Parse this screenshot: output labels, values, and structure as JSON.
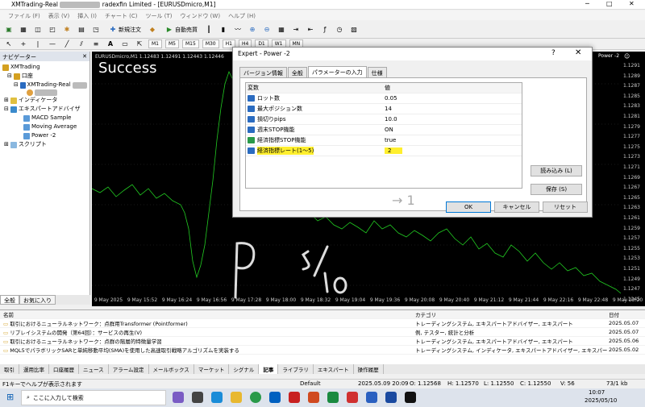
{
  "window": {
    "title_prefix": "XMTrading-Real",
    "title_suffix": "radexfin Limited - [EURUSDmicro,M1]"
  },
  "menu": [
    "ファイル (F)",
    "表示 (V)",
    "挿入 (I)",
    "チャート (C)",
    "ツール (T)",
    "ウィンドウ (W)",
    "ヘルプ (H)"
  ],
  "toolbar": {
    "new_order": "新規注文",
    "auto_trade": "自動売買"
  },
  "timeframes": [
    "M1",
    "M5",
    "M15",
    "M30",
    "H1",
    "H4",
    "D1",
    "W1",
    "MN"
  ],
  "navigator": {
    "title": "ナビゲーター",
    "items": [
      "XMTrading",
      "口座",
      "XMTrading-Real",
      "インディケータ",
      "エキスパートアドバイザ",
      "MACD Sample",
      "Moving Average",
      "Power -2",
      "スクリプト"
    ],
    "tabs": [
      "全般",
      "お気に入り"
    ]
  },
  "chart": {
    "symbol_label": "EURUSDmicro,M1 1.12483 1.12491 1.12443 1.12446",
    "overlay_text": "Success",
    "tab_label": "Power -2",
    "time_labels": [
      "9 May 2025",
      "9 May 15:52",
      "9 May 16:24",
      "9 May 16:56",
      "9 May 17:28",
      "9 May 18:00",
      "9 May 18:32",
      "9 May 19:04",
      "9 May 19:36",
      "9 May 20:08",
      "9 May 20:40",
      "9 May 21:12",
      "9 May 21:44",
      "9 May 22:16",
      "9 May 22:48",
      "9 May 23:20"
    ],
    "prices": [
      "1.1291",
      "1.1289",
      "1.1287",
      "1.1285",
      "1.1283",
      "1.1281",
      "1.1279",
      "1.1277",
      "1.1275",
      "1.1273",
      "1.1271",
      "1.1269",
      "1.1267",
      "1.1265",
      "1.1263",
      "1.1261",
      "1.1259",
      "1.1257",
      "1.1255",
      "1.1253",
      "1.1251",
      "1.1249",
      "1.1247",
      "1.1245"
    ],
    "handwriting": [
      "P",
      "5/10"
    ]
  },
  "dialog": {
    "title": "Expert - Power -2",
    "help": "?",
    "close": "✕",
    "tabs": [
      "バージョン情報",
      "全般",
      "パラメーターの入力",
      "仕様"
    ],
    "active_tab": 2,
    "columns": [
      "変数",
      "値"
    ],
    "params": [
      {
        "name": "ロット数",
        "value": "0.05"
      },
      {
        "name": "最大ポジション数",
        "value": "14"
      },
      {
        "name": "損切りpips",
        "value": "10.0"
      },
      {
        "name": "週末STOP機能",
        "value": "ON"
      },
      {
        "name": "経済指標STOP機能",
        "value": "true"
      },
      {
        "name": "経済指標レート(1〜5)",
        "value": "2"
      }
    ],
    "annotation": "→ 1",
    "buttons": {
      "load": "読み込み (L)",
      "save": "保存 (S)",
      "ok": "OK",
      "cancel": "キャンセル",
      "reset": "リセット"
    }
  },
  "terminal": {
    "columns": [
      "名前",
      "カテゴリ",
      "日付"
    ],
    "rows": [
      {
        "name": "取引におけるニューラルネットワーク：点群用Transformer (Pointformer)",
        "cat": "トレーディングシステム, エキスパートアドバイザー, エキスパート",
        "date": "2025.05.07"
      },
      {
        "name": "リプレイシステムの開発（第64回）：サービスの再生(V)",
        "cat": "例, テスター, 統計と分析",
        "date": "2025.05.07"
      },
      {
        "name": "取引におけるニューラルネットワーク：点群の階層的特徴量学習",
        "cat": "トレーディングシステム, エキスパートアドバイザー, エキスパート",
        "date": "2025.05.06"
      },
      {
        "name": "MQL5でパラボリックSARと単純移動平均(SMA)を使用した高速取引戦略アルゴリズムを実装する",
        "cat": "トレーディングシステム, インディケータ, エキスパートアドバイザー, エキスパート",
        "date": "2025.05.02"
      }
    ],
    "tabs": [
      "取引",
      "運用比率",
      "口座履歴",
      "ニュース",
      "アラーム設定",
      "メールボックス",
      "マーケット",
      "シグナル",
      "記事",
      "ライブラリ",
      "エキスパート",
      "操作履歴"
    ],
    "active_tab": 8
  },
  "status": {
    "help": "F1キーでヘルプが表示されます",
    "profile": "Default",
    "datetime": "2025.05.09 20:09",
    "o": "O: 1.12568",
    "h": "H: 1.12570",
    "l": "L: 1.12550",
    "c": "C: 1.12550",
    "v": "V: 56",
    "net": "73/1 kb"
  },
  "taskbar": {
    "search": "ここに入力して検索",
    "time": "10:07",
    "date": "2025/05/10"
  }
}
